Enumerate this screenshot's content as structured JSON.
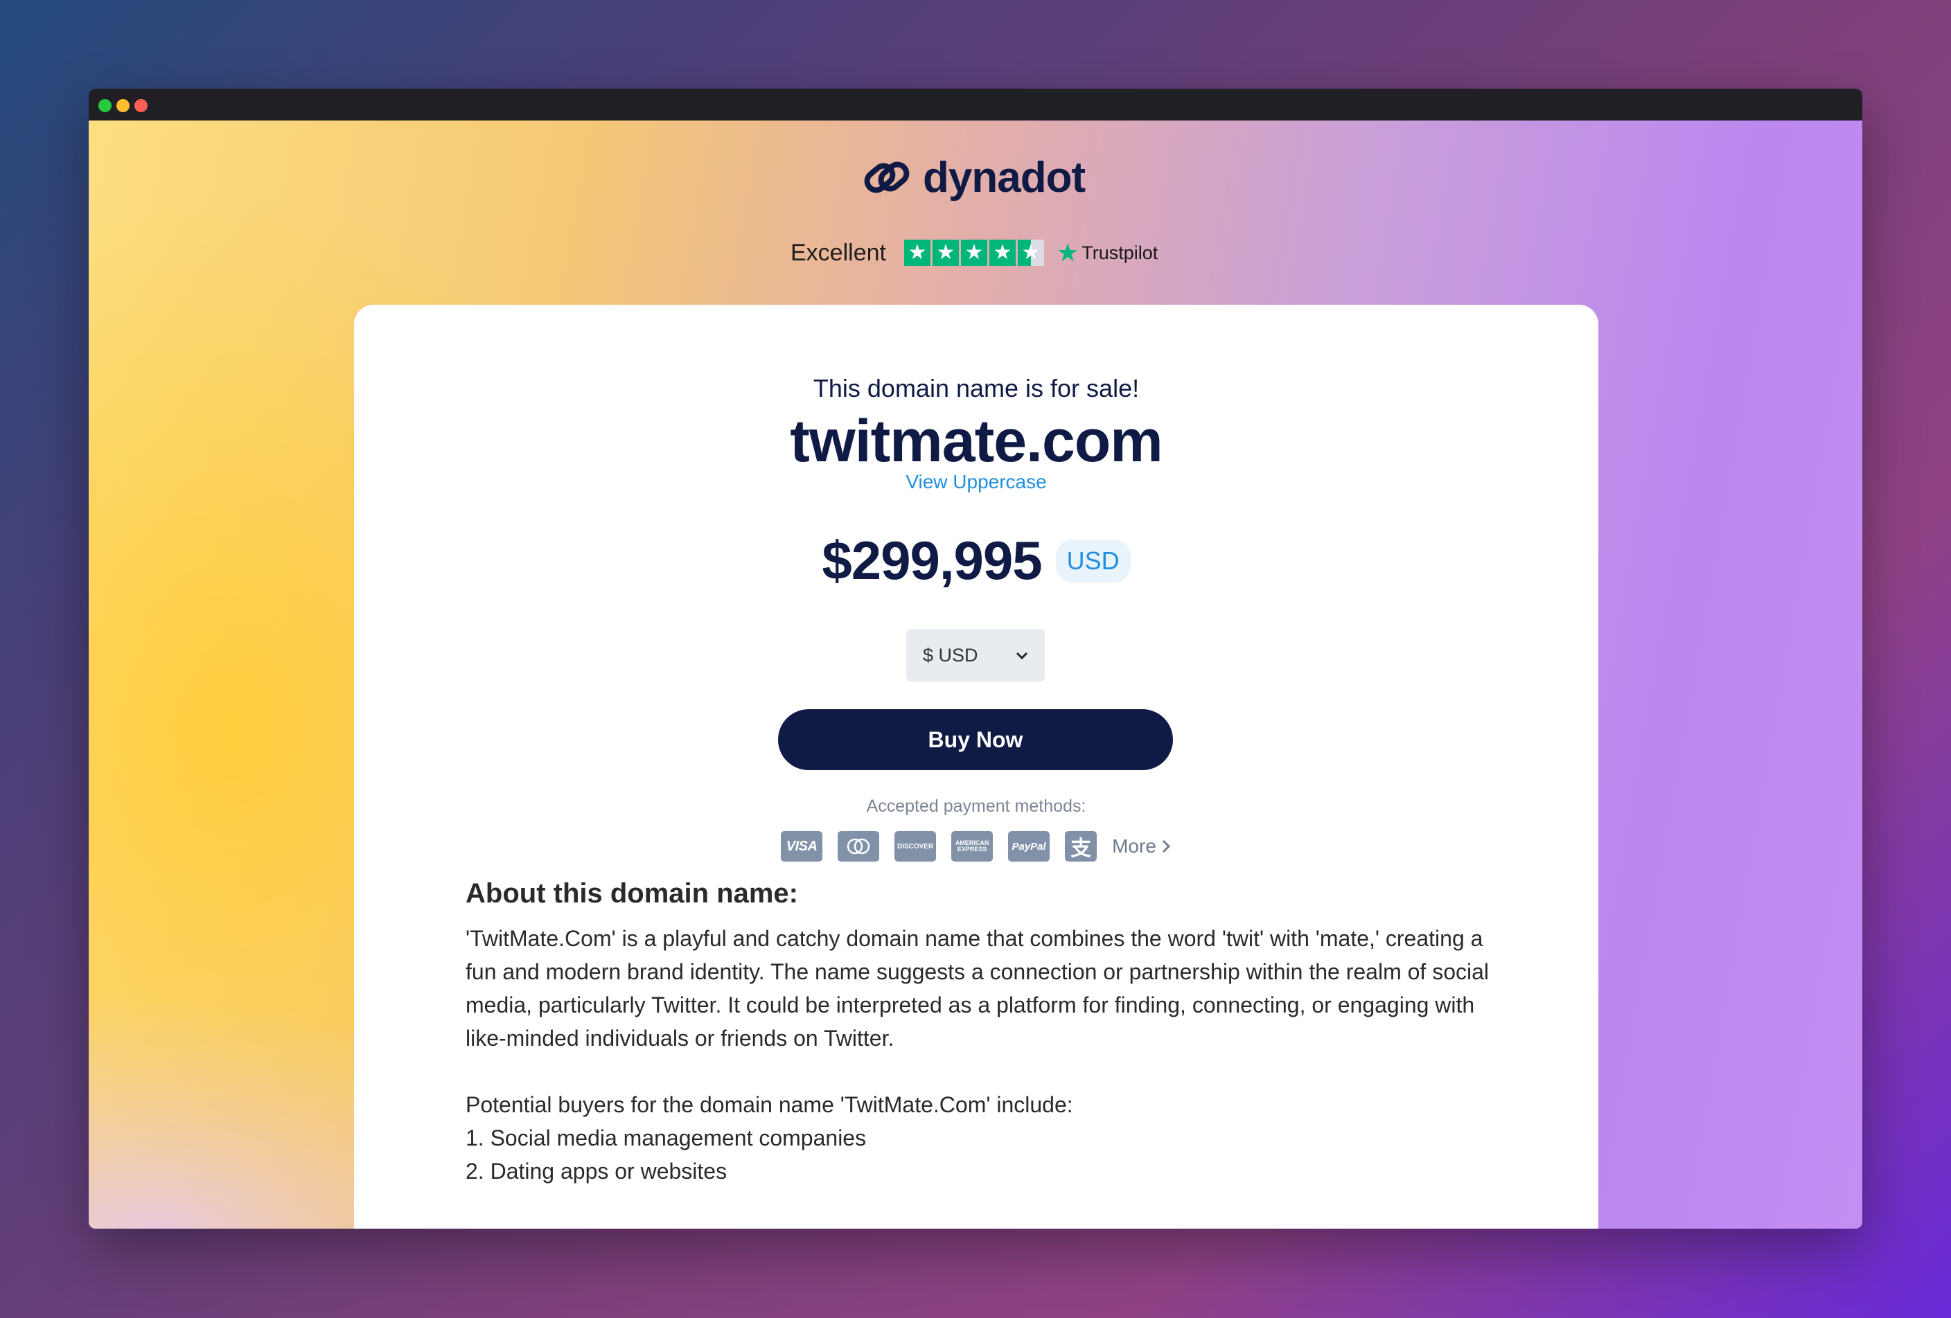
{
  "brand": {
    "name": "dynadot",
    "accent": "#0f1a45",
    "link_color": "#1f8fe0"
  },
  "trustpilot": {
    "label": "Excellent",
    "rating_stars": 4.5,
    "brand": "Trustpilot",
    "star_color": "#00b67a"
  },
  "listing": {
    "heading": "This domain name is for sale!",
    "domain": "twitmate.com",
    "view_uppercase": "View Uppercase",
    "price": "$299,995",
    "currency_badge": "USD",
    "currency_select": "$ USD",
    "buy_button": "Buy Now",
    "payments_label": "Accepted payment methods:",
    "payment_methods": [
      "visa-icon",
      "mastercard-icon",
      "discover-icon",
      "amex-icon",
      "paypal-icon",
      "alipay-icon"
    ],
    "more": "More"
  },
  "about": {
    "title": "About this domain name:",
    "paragraph": "'TwitMate.Com' is a playful and catchy domain name that combines the word 'twit' with 'mate,' creating a fun and modern brand identity. The name suggests a connection or partnership within the realm of social media, particularly Twitter. It could be interpreted as a platform for finding, connecting, or engaging with like-minded individuals or friends on Twitter.",
    "buyers_intro": "Potential buyers for the domain name 'TwitMate.Com' include:",
    "buyers": [
      "1. Social media management companies",
      "2. Dating apps or websites"
    ]
  }
}
